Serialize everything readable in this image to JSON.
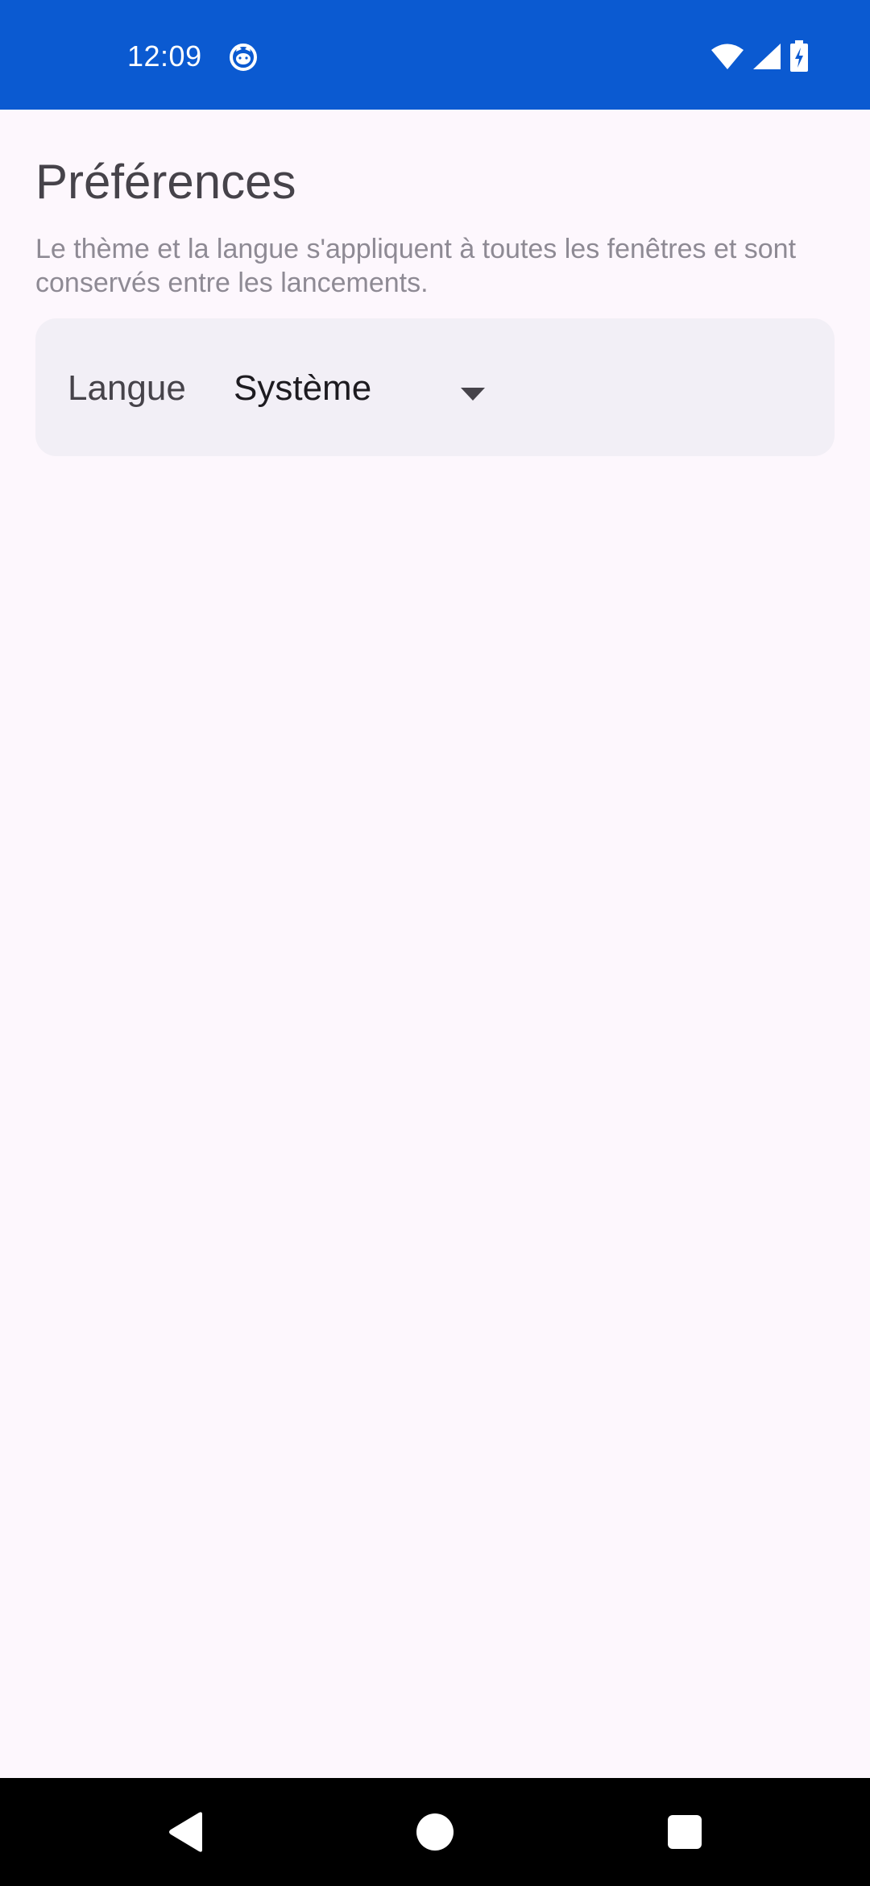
{
  "status_bar": {
    "time": "12:09",
    "app_icon": "cat-face-icon",
    "icons": [
      "wifi-icon",
      "cell-signal-icon",
      "battery-charging-icon"
    ],
    "background": "#0b5ad1"
  },
  "page": {
    "title": "Préférences",
    "description": "Le thème et la langue s'appliquent à toutes les fenêtres et sont conservés entre les lancements."
  },
  "language_setting": {
    "label": "Langue",
    "selected_value": "Système",
    "dropdown_icon": "caret-down-icon"
  },
  "nav_bar": {
    "buttons": [
      "back-icon",
      "home-icon",
      "recents-icon"
    ]
  },
  "colors": {
    "accent": "#0b5ad1",
    "background": "#fdf7fd",
    "card": "#f2eff6",
    "title_text": "#46434a",
    "secondary_text": "#8e8a94"
  }
}
